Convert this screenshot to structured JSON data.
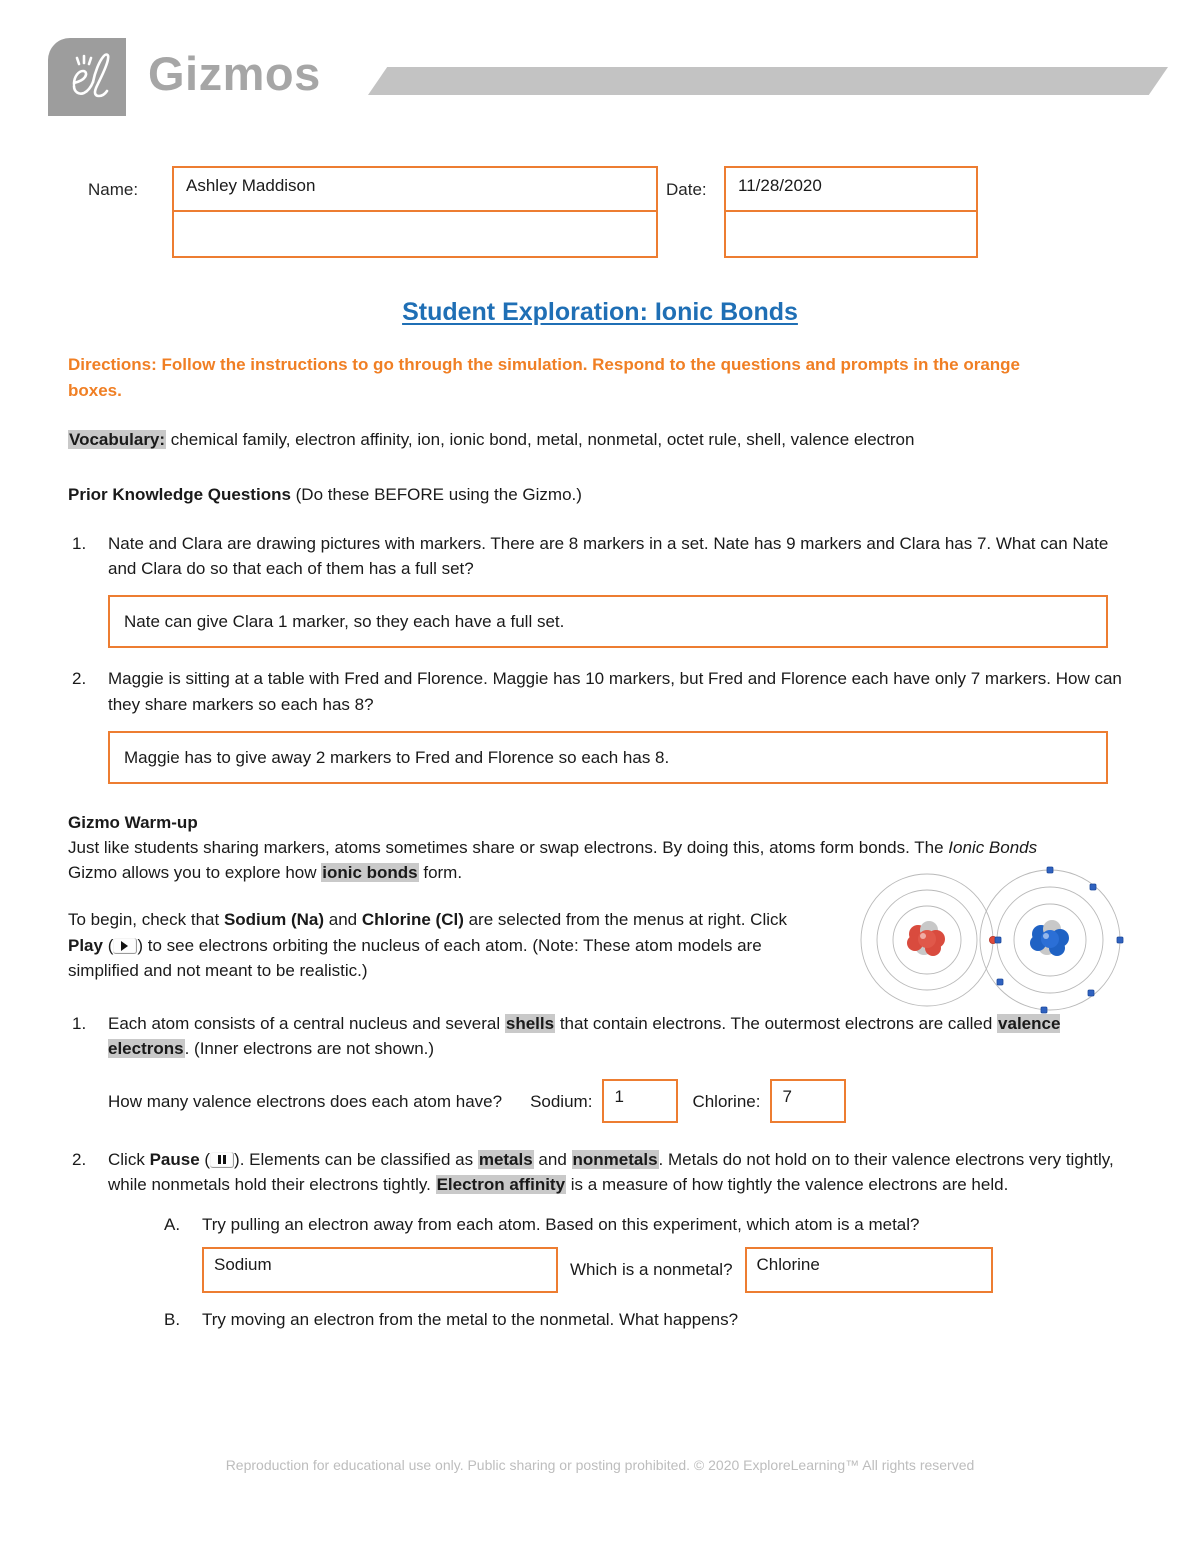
{
  "brand": {
    "logo_icon": "explorelearning-el-logo-icon",
    "wordmark": "Gizmos"
  },
  "header_fields": {
    "name_label": "Name:",
    "name_value": "Ashley Maddison",
    "name_value_2": "",
    "date_label": "Date:",
    "date_value": "11/28/2020",
    "date_value_2": ""
  },
  "title": "Student Exploration: Ionic Bonds",
  "directions": "Directions: Follow the instructions to go through the simulation. Respond to the questions and prompts in the orange boxes.",
  "vocabulary": {
    "label": "Vocabulary:",
    "terms": " chemical family, electron affinity, ion, ionic bond, metal, nonmetal, octet rule, shell, valence electron"
  },
  "prior_knowledge": {
    "heading_bold": "Prior Knowledge Questions",
    "heading_rest": " (Do these BEFORE using the Gizmo.)",
    "questions": [
      {
        "num": "1.",
        "text": "Nate and Clara are drawing pictures with markers. There are 8 markers in a set. Nate has 9 markers and Clara has 7. What can Nate and Clara do so that each of them has a full set?",
        "answer": "Nate can give Clara 1 marker, so they each have a full set."
      },
      {
        "num": "2.",
        "text": "Maggie is sitting at a table with Fred and Florence. Maggie has 10 markers, but Fred and Florence each have only 7 markers. How can they share markers so each has 8?",
        "answer": "Maggie has to give away 2 markers to Fred and Florence so each has 8."
      }
    ]
  },
  "warmup": {
    "heading": "Gizmo Warm-up",
    "p1_a": "Just like students sharing markers, atoms sometimes share or swap electrons. By doing this, atoms form bonds. The ",
    "p1_italic": "Ionic Bonds",
    "p1_b": " Gizmo allows you to explore how ",
    "p1_highlight": "ionic bonds",
    "p1_c": " form.",
    "p2_a": "To begin, check that ",
    "p2_bold1": "Sodium (Na)",
    "p2_b": " and ",
    "p2_bold2": "Chlorine (Cl)",
    "p2_c": " are selected from the menus at right. Click ",
    "p2_bold3": "Play",
    "p2_d": " (",
    "p2_e": ") to see electrons orbiting the nucleus of each atom. (Note: These atom models are simplified and not meant to be realistic.)",
    "figure_name": "sodium-chlorine-atom-diagram"
  },
  "gizmo_questions": [
    {
      "num": "1.",
      "t_a": "Each atom consists of a central nucleus and several ",
      "t_hl1": "shells",
      "t_b": " that contain electrons. The outermost electrons are called ",
      "t_hl2": "valence electrons",
      "t_c": ". (Inner electrons are not shown.)",
      "prompt": "How many valence electrons does each atom have?",
      "sodium_label": "Sodium:",
      "sodium_value": "1",
      "chlorine_label": "Chlorine:",
      "chlorine_value": "7"
    },
    {
      "num": "2.",
      "t_a": "Click ",
      "t_bold": "Pause",
      "t_b": " (",
      "t_c": "). Elements can be classified as ",
      "t_hl1": "metals",
      "t_d": " and ",
      "t_hl2": "nonmetals",
      "t_e": ". Metals do not hold on to their valence electrons very tightly, while nonmetals hold their electrons tightly. ",
      "t_hl3": "Electron affinity",
      "t_f": " is a measure of how tightly the valence electrons are held.",
      "sub": [
        {
          "letter": "A.",
          "text": "Try pulling an electron away from each atom. Based on this experiment, which atom is a metal?",
          "answer1": "Sodium",
          "mid_label": "Which is a nonmetal?",
          "answer2": "Chlorine"
        },
        {
          "letter": "B.",
          "text": "Try moving an electron from the metal to the nonmetal. What happens?"
        }
      ]
    }
  ],
  "footer": "Reproduction for educational use only. Public sharing or posting prohibited. © 2020 ExploreLearning™ All rights reserved",
  "colors": {
    "accent_orange": "#ED7D31",
    "title_blue": "#1F6FB5",
    "brand_gray": "#9d9d9d",
    "highlight_gray": "#c9c9c9"
  }
}
